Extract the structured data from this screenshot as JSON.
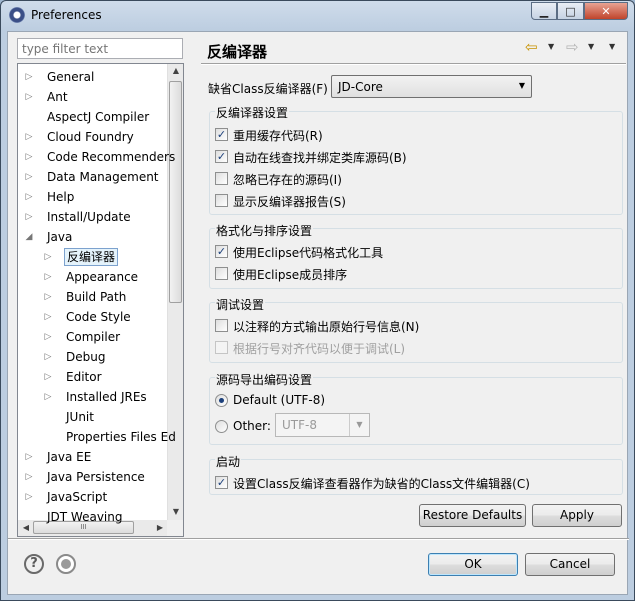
{
  "window": {
    "title": "Preferences",
    "controls": {
      "minimize": "▁",
      "maximize": "□",
      "close": "✕"
    }
  },
  "filter": {
    "placeholder": "type filter text"
  },
  "tree": {
    "items": [
      {
        "label": "General",
        "expander": "▷"
      },
      {
        "label": "Ant",
        "expander": "▷"
      },
      {
        "label": "AspectJ Compiler",
        "expander": ""
      },
      {
        "label": "Cloud Foundry",
        "expander": "▷"
      },
      {
        "label": "Code Recommenders",
        "expander": "▷"
      },
      {
        "label": "Data Management",
        "expander": "▷"
      },
      {
        "label": "Help",
        "expander": "▷"
      },
      {
        "label": "Install/Update",
        "expander": "▷"
      },
      {
        "label": "Java",
        "expander": "◢"
      },
      {
        "label": "反编译器",
        "expander": "▷",
        "selected": true
      },
      {
        "label": "Appearance",
        "expander": "▷"
      },
      {
        "label": "Build Path",
        "expander": "▷"
      },
      {
        "label": "Code Style",
        "expander": "▷"
      },
      {
        "label": "Compiler",
        "expander": "▷"
      },
      {
        "label": "Debug",
        "expander": "▷"
      },
      {
        "label": "Editor",
        "expander": "▷"
      },
      {
        "label": "Installed JREs",
        "expander": "▷"
      },
      {
        "label": "JUnit",
        "expander": ""
      },
      {
        "label": "Properties Files Ed",
        "expander": ""
      },
      {
        "label": "Java EE",
        "expander": "▷"
      },
      {
        "label": "Java Persistence",
        "expander": "▷"
      },
      {
        "label": "JavaScript",
        "expander": "▷"
      },
      {
        "label": "JDT Weaving",
        "expander": ""
      }
    ],
    "scroll_up": "▲",
    "scroll_down": "▼",
    "scroll_left": "◀",
    "scroll_right": "▶",
    "hthumb_grip": "III"
  },
  "page": {
    "title": "反编译器",
    "back_icon": "⇦",
    "forward_icon": "⇨",
    "dropdown_glyph": "▼",
    "default_decompiler_label": "缺省Class反编译器(F)",
    "default_decompiler_value": "JD-Core",
    "decompiler_settings": {
      "title": "反编译器设置",
      "options": [
        {
          "label": "重用缓存代码(R)",
          "checked": true
        },
        {
          "label": "自动在线查找并绑定类库源码(B)",
          "checked": true
        },
        {
          "label": "忽略已存在的源码(I)",
          "checked": false
        },
        {
          "label": "显示反编译器报告(S)",
          "checked": false
        }
      ]
    },
    "format_settings": {
      "title": "格式化与排序设置",
      "options": [
        {
          "label": "使用Eclipse代码格式化工具",
          "checked": true
        },
        {
          "label": "使用Eclipse成员排序",
          "checked": false
        }
      ]
    },
    "debug_settings": {
      "title": "调试设置",
      "options": [
        {
          "label": "以注释的方式输出原始行号信息(N)",
          "checked": false
        },
        {
          "label": "根据行号对齐代码以便于调试(L)",
          "checked": false,
          "disabled": true
        }
      ]
    },
    "encoding_settings": {
      "title": "源码导出编码设置",
      "default_option": "Default (UTF-8)",
      "other_option": "Other:",
      "other_value": "UTF-8",
      "selected": "default"
    },
    "startup": {
      "title": "启动",
      "option": "设置Class反编译查看器作为缺省的Class文件编辑器(C)",
      "checked": true
    },
    "restore_defaults": "Restore Defaults",
    "apply": "Apply"
  },
  "footer": {
    "help_icon_glyph": "?",
    "ok": "OK",
    "cancel": "Cancel"
  },
  "check_glyph": "✓"
}
